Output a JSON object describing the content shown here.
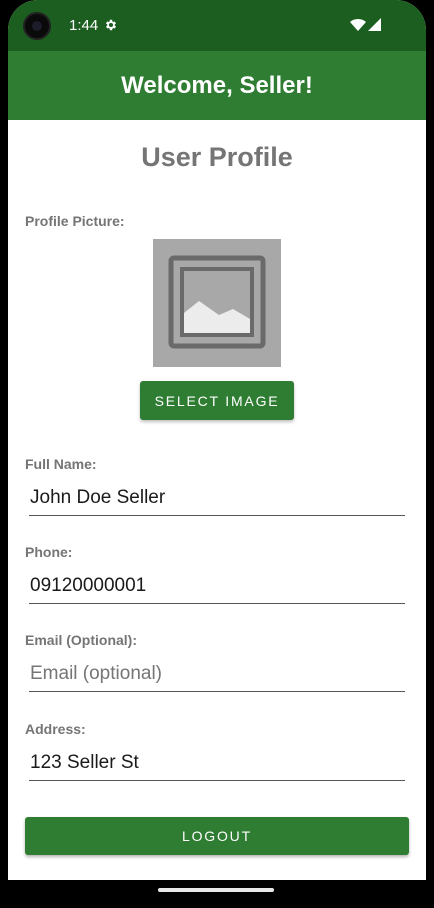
{
  "status_bar": {
    "time": "1:44",
    "icons": [
      "settings-gear-icon",
      "wifi-icon",
      "cellular-signal-icon"
    ]
  },
  "app_bar": {
    "title": "Welcome, Seller!"
  },
  "profile": {
    "title": "User Profile",
    "picture_label": "Profile Picture:",
    "picture_icon": "image-placeholder-icon",
    "select_image_label": "SELECT IMAGE",
    "full_name": {
      "label": "Full Name:",
      "value": "John Doe Seller"
    },
    "phone": {
      "label": "Phone:",
      "value": "09120000001"
    },
    "email": {
      "label": "Email (Optional):",
      "value": "",
      "placeholder": "Email (optional)"
    },
    "address": {
      "label": "Address:",
      "value": "123 Seller St"
    },
    "logout_label": "LOGOUT"
  },
  "colors": {
    "status_bar": "#1b5e20",
    "primary": "#2e7d32",
    "label_gray": "#757575",
    "image_placeholder_bg": "#a8a8a8"
  }
}
